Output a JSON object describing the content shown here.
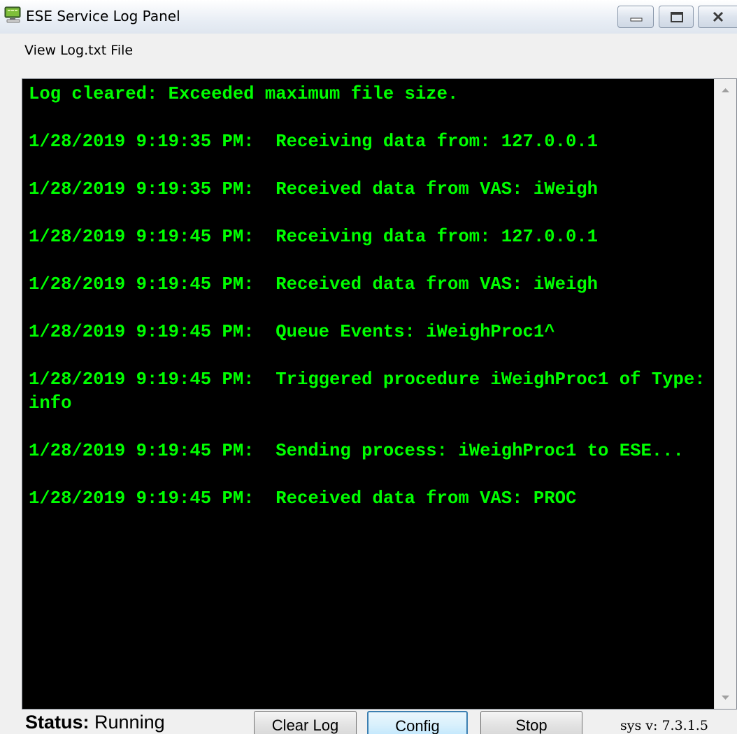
{
  "window": {
    "title": "ESE Service Log Panel",
    "app_icon": "computer-monitor-icon",
    "controls": {
      "minimize_icon": "minimize-icon",
      "maximize_icon": "maximize-icon",
      "close_icon": "close-icon"
    }
  },
  "menu": {
    "items": [
      {
        "label": "View Log.txt File"
      }
    ]
  },
  "log": {
    "text_color": "#00ff00",
    "background_color": "#000000",
    "lines": [
      "Log cleared: Exceeded maximum file size.",
      "1/28/2019 9:19:35 PM:  Receiving data from: 127.0.0.1",
      "1/28/2019 9:19:35 PM:  Received data from VAS: iWeigh",
      "1/28/2019 9:19:45 PM:  Receiving data from: 127.0.0.1",
      "1/28/2019 9:19:45 PM:  Received data from VAS: iWeigh",
      "1/28/2019 9:19:45 PM:  Queue Events: iWeighProc1^",
      "1/28/2019 9:19:45 PM:  Triggered procedure iWeighProc1 of Type: info",
      "1/28/2019 9:19:45 PM:  Sending process: iWeighProc1 to ESE...",
      "1/28/2019 9:19:45 PM:  Received data from VAS: PROC"
    ],
    "scrollbar": {
      "up_icon": "scroll-up-arrow-icon",
      "down_icon": "scroll-down-arrow-icon"
    }
  },
  "footer": {
    "status_label": "Status:",
    "status_value": "Running",
    "buttons": {
      "clear_log": "Clear Log",
      "config": "Config",
      "stop": "Stop"
    },
    "version": "sys v: 7.3.1.5"
  }
}
